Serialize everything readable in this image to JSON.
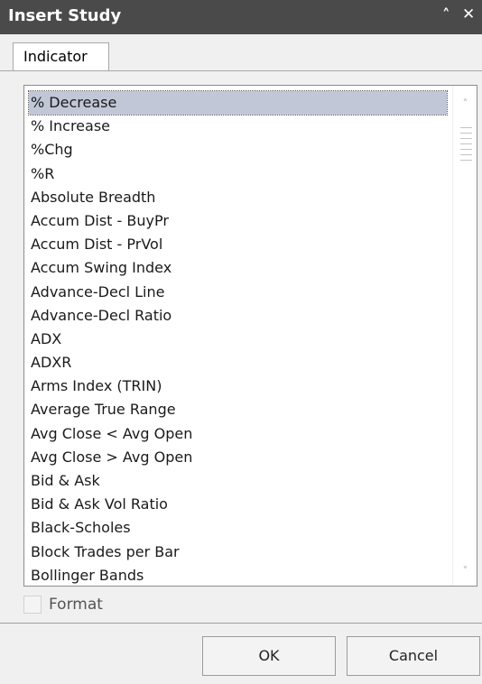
{
  "window": {
    "title": "Insert Study",
    "collapse_glyph": "˄",
    "close_glyph": "✕"
  },
  "tabs": [
    {
      "label": "Indicator"
    }
  ],
  "study_list": {
    "selected_index": 0,
    "items": [
      "% Decrease",
      "% Increase",
      "%Chg",
      "%R",
      "Absolute Breadth",
      "Accum Dist - BuyPr",
      "Accum Dist - PrVol",
      "Accum Swing Index",
      "Advance-Decl Line",
      "Advance-Decl Ratio",
      "ADX",
      "ADXR",
      "Arms Index (TRIN)",
      "Average True Range",
      "Avg Close < Avg Open",
      "Avg Close > Avg Open",
      "Bid & Ask",
      "Bid & Ask Vol Ratio",
      "Black-Scholes",
      "Block Trades per Bar",
      "Bollinger Bands"
    ]
  },
  "scrollbar": {
    "up_glyph": "˄",
    "down_glyph": "˅"
  },
  "format_checkbox": {
    "label": "Format",
    "checked": false
  },
  "buttons": {
    "ok_label": "OK",
    "cancel_label": "Cancel"
  }
}
